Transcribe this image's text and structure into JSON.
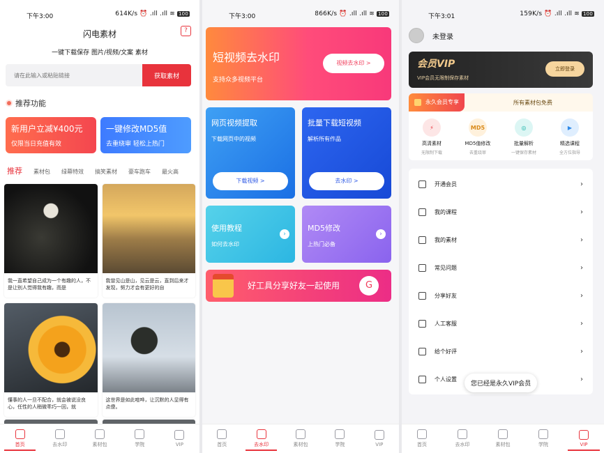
{
  "panel1": {
    "status": {
      "time": "下午3:00",
      "net": "614K/s",
      "battery": "100"
    },
    "title": "闪电素材",
    "help_icon": "?",
    "subtitle": "一键下载保存 图片/视频/文案 素材",
    "search": {
      "placeholder": "请在此输入或粘贴链接",
      "button": "获取素材"
    },
    "section": "推荐功能",
    "promos": [
      {
        "title": "新用户立减¥400元",
        "sub": "仅限当日充值有效"
      },
      {
        "title": "一键修改MD5值",
        "sub": "去重绕审 轻松上热门"
      }
    ],
    "categories": [
      "推荐",
      "素材包",
      "绿幕特效",
      "搞笑素材",
      "豪车跑车",
      "最火高"
    ],
    "cards": [
      {
        "text": "我一直希望自己成为一个有趣的人，不是让别人觉得我有趣，而是"
      },
      {
        "text": "我曾见山是山，见云是云，直到后来才发现，努力才会有更好的自"
      },
      {
        "text": "懂事的人一旦不配合，就会被说没良心，任性的人稍微乖巧一回，就"
      },
      {
        "text": "这世界是如此喧哗，让沉默的人显得有点傻。"
      }
    ],
    "tabs": [
      "首页",
      "去水印",
      "素材包",
      "学院",
      "VIP"
    ]
  },
  "panel2": {
    "status": {
      "time": "下午3:00",
      "net": "866K/s",
      "battery": "100"
    },
    "banner": {
      "title": "短视频去水印",
      "sub": "支持众多视频平台",
      "button": "视频去水印 >"
    },
    "cards": [
      {
        "title": "网页视频提取",
        "sub": "下载网页中的视频",
        "button": "下载视频 >"
      },
      {
        "title": "批量下载短视频",
        "sub": "解析所有作品",
        "button": "去水印 >"
      }
    ],
    "small": [
      {
        "title": "使用教程",
        "sub": "如何去水印"
      },
      {
        "title": "MD5修改",
        "sub": "上热门必备"
      }
    ],
    "share": "好工具分享好友一起使用",
    "tabs": [
      "首页",
      "去水印",
      "素材包",
      "学院",
      "VIP"
    ]
  },
  "panel3": {
    "status": {
      "time": "下午3:01",
      "net": "159K/s",
      "battery": "100"
    },
    "user": "未登录",
    "vip": {
      "title": "会员VIP",
      "sub": "VIP会员无限制保存素材",
      "button": "立即登录"
    },
    "perm": {
      "tag": "永久会员专享",
      "note": "所有素材包免费"
    },
    "features": [
      {
        "name": "高清素材",
        "desc": "无限制下载",
        "icon": "flash-icon"
      },
      {
        "name": "MD5值修改",
        "desc": "去重绕审",
        "icon": "MD5"
      },
      {
        "name": "批量解析",
        "desc": "一键保存素材",
        "icon": "batch-icon"
      },
      {
        "name": "精选课程",
        "desc": "全方位指导",
        "icon": "course-icon"
      }
    ],
    "menu": [
      "开通会员",
      "我的课程",
      "我的素材",
      "常见问题",
      "分享好友",
      "人工客服",
      "给个好评",
      "个人设置"
    ],
    "toast": "您已经是永久VIP会员",
    "tabs": [
      "首页",
      "去水印",
      "素材包",
      "学院",
      "VIP"
    ]
  },
  "colors": {
    "accent": "#e8333c",
    "blue": "#2f5ae5",
    "vip_gold": "#f1c98c"
  }
}
